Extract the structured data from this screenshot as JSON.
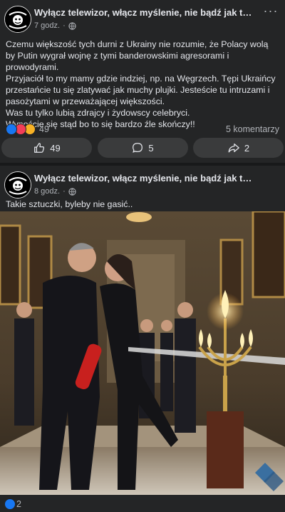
{
  "posts": [
    {
      "page_name": "Wyłącz telewizor, włącz myślenie, nie bądź jak te ludz…",
      "time": "7 godz.",
      "text_lines": [
        "Czemu większość tych durni z Ukrainy nie rozumie, że Polacy wolą by Putin wygrał wojnę z  tymi banderowskimi agresorami i prowodyrami.",
        "Przyjaciół to my mamy gdzie indziej, np. na Węgrzech. Tępi Ukraińcy przestańcie tu się zlatywać jak muchy plujki. Jesteście tu intruzami i pasożytami w przeważającej większości.",
        "Was tu tylko lubią zdrajcy i żydowscy celebryci.",
        "Wynoście się stąd bo to się bardzo źle skończy!!"
      ],
      "reaction_count": "49",
      "comments": "5 komentarzy",
      "actions": {
        "like": "49",
        "comment": "5",
        "share": "2"
      }
    },
    {
      "page_name": "Wyłącz telewizor, włącz myślenie, nie bądź jak te ludz…",
      "time": "8 godz.",
      "text": "Takie sztuczki, byleby nie gasić..",
      "reaction_count": "2"
    }
  ],
  "icons": {
    "menu": "more-dots-icon",
    "audience": "globe-icon",
    "like": "thumbs-up-icon",
    "comment": "comment-bubble-icon",
    "share": "share-arrow-icon"
  },
  "colors": {
    "background": "#18191a",
    "card": "#242526",
    "button": "#3a3b3c",
    "like_blue": "#1877f2",
    "love_red": "#f33e58",
    "haha_yellow": "#f7b125"
  }
}
